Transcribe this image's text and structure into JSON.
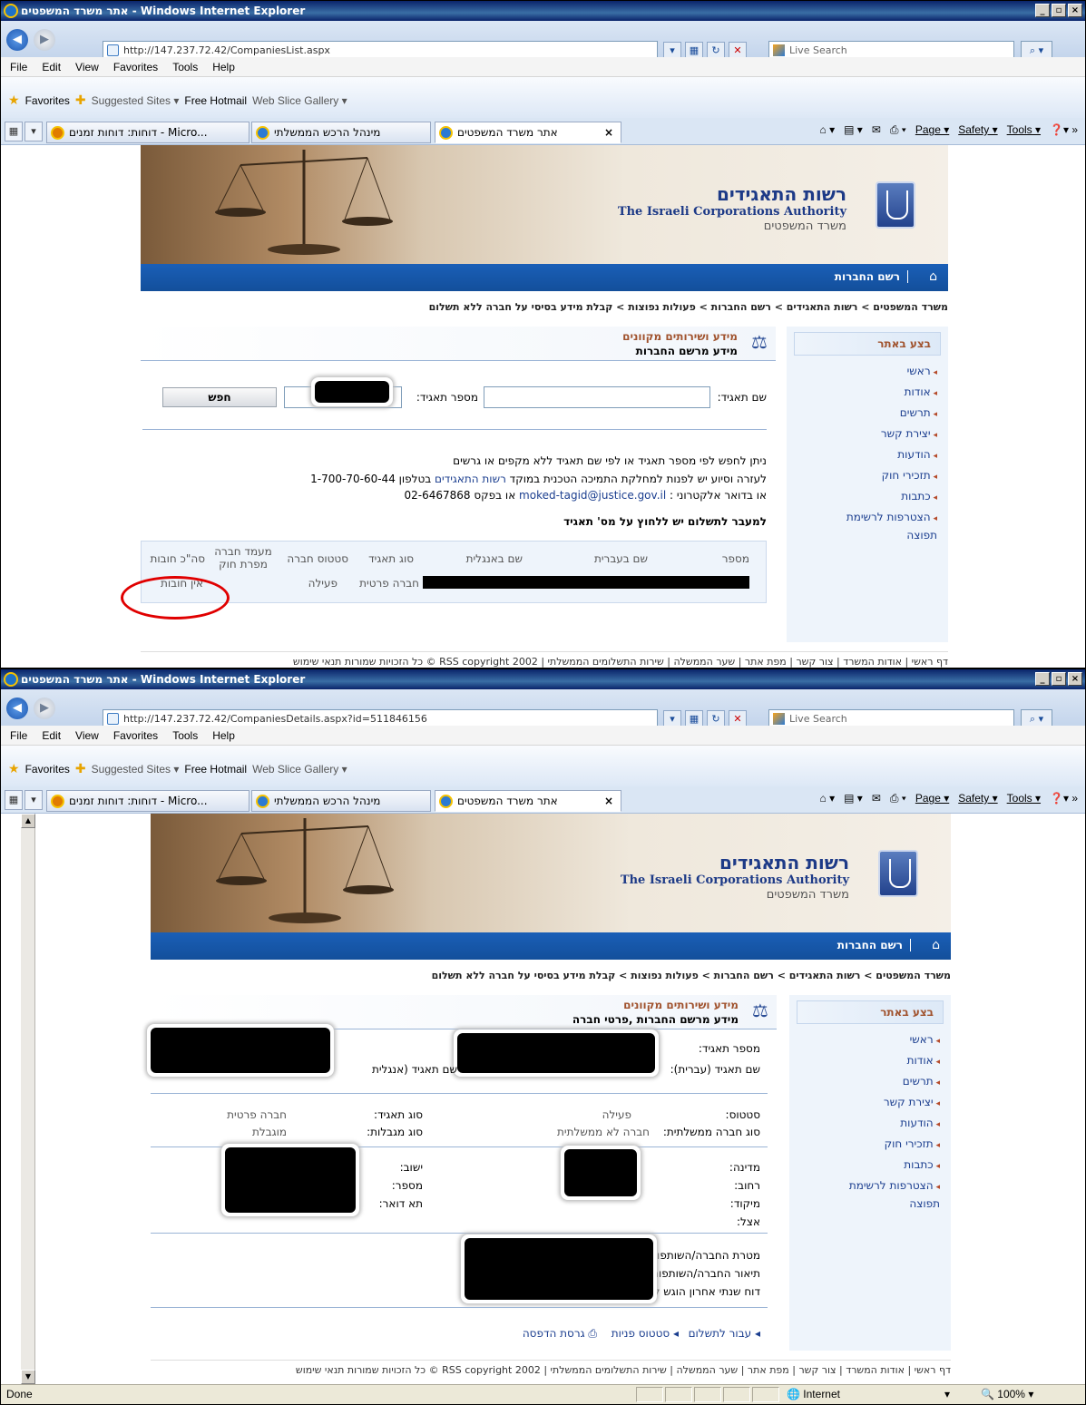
{
  "browser": {
    "window_title": "אתר משרד המשפטים - Windows Internet Explorer",
    "menu": [
      "File",
      "Edit",
      "View",
      "Favorites",
      "Tools",
      "Help"
    ],
    "favorites_label": "Favorites",
    "suggested_sites": "Suggested Sites ▾",
    "free_hotmail": "Free Hotmail",
    "web_slice": "Web Slice Gallery ▾",
    "tabs": [
      "דוחות: דוחות זמנים - Micro...",
      "מינהל הרכש הממשלתי",
      "אתר משרד המשפטים"
    ],
    "commands": [
      "Page ▾",
      "Safety ▾",
      "Tools ▾"
    ],
    "search_placeholder": "Live Search",
    "status_done": "Done",
    "zone": "Internet",
    "zoom": "100%"
  },
  "screen1": {
    "url": "http://147.237.72.42/CompaniesList.aspx"
  },
  "screen2": {
    "url": "http://147.237.72.42/CompaniesDetails.aspx?id=511846156"
  },
  "site": {
    "title_he": "רשות התאגידים",
    "title_en": "The Israeli Corporations Authority",
    "ministry": "משרד המשפטים",
    "nav_registry": "רשם החברות",
    "breadcrumb": "משרד המשפטים > רשות התאגידים > רשם החברות > פעולות נפוצות > קבלת מידע בסיסי על חברה ללא תשלום",
    "side_title": "בצע באתר",
    "side_items": [
      "ראשי",
      "אודות",
      "תרשים",
      "יצירת קשר",
      "הודעות",
      "תזכירי חוק",
      "כתבות"
    ],
    "side_last_1": "הצטרפות לרשימת תפוצה",
    "side_last_2": "הצטרפות לרשימת תפוצה",
    "head_1": "מידע ושירותים מקוונים",
    "head_2_list": "מידע מרשם החברות",
    "head_2_details": "מידע מרשם החברות ,פרטי חברה",
    "footer": "דף ראשי | אודות המשרד | צור קשר | מפת אתר | שער הממשלה | שירות התשלומים הממשלתי | RSS  copyright 2002 © כל הזכויות שמורות  תנאי שימוש"
  },
  "search_form": {
    "name_label": "שם תאגיד:",
    "number_label": "מספר תאגיד:",
    "search_btn": "חפש",
    "help1": "ניתן לחפש לפי מספר תאגיד או לפי שם תאגיד ללא מקפים או גרשים",
    "help2a": "לעזרה וסיוע יש לפנות למחלקת התמיכה הטכנית במוקד ",
    "help2b": "רשות התאגידים",
    "help2c": " בטלפון 1-700-70-60-44",
    "help3a": "או בדואר אלקטרוני : ",
    "help3b": "moked-tagid@justice.gov.il",
    "help3c": " או בפקס 02-6467868",
    "pay_note": "למעבר לתשלום יש ללחוץ על מס' תאגיד"
  },
  "results": {
    "headers": [
      "מספר",
      "שם בעברית",
      "שם באנגלית",
      "סוג תאגיד",
      "סטטוס חברה",
      "מעמד חברה מפרת חוק",
      "סה\"כ חובות"
    ],
    "row": {
      "type": "חברה פרטית",
      "status": "פעילה",
      "debts": "אין חובות"
    }
  },
  "details": {
    "number_label": "מספר תאגיד:",
    "name_he_label": "שם תאגיד (עברית):",
    "name_en_label": "שם תאגיד (אנגלית",
    "status_label": "סטטוס:",
    "status_val": "פעילה",
    "type_label": "סוג תאגיד:",
    "type_val": "חברה פרטית",
    "gov_label": "סוג חברה ממשלתית:",
    "gov_val": "חברה לא ממשלתית",
    "limit_label": "סוג מגבלות:",
    "limit_val": "מוגבלת",
    "country": "מדינה:",
    "street": "רחוב:",
    "zip": "מיקוד:",
    "at": "אצל:",
    "city": "ישוב:",
    "num": "מספר:",
    "pobox": "תא דואר:",
    "goal": "מטרת החברה/השותפות:",
    "desc": "תיאור החברה/השותפות:",
    "report": "דוח שנתי אחרון הוגש לש",
    "act_pay": "עבור לתשלום",
    "act_status": "סטטוס פניות",
    "act_print": "גרסת הדפסה"
  }
}
